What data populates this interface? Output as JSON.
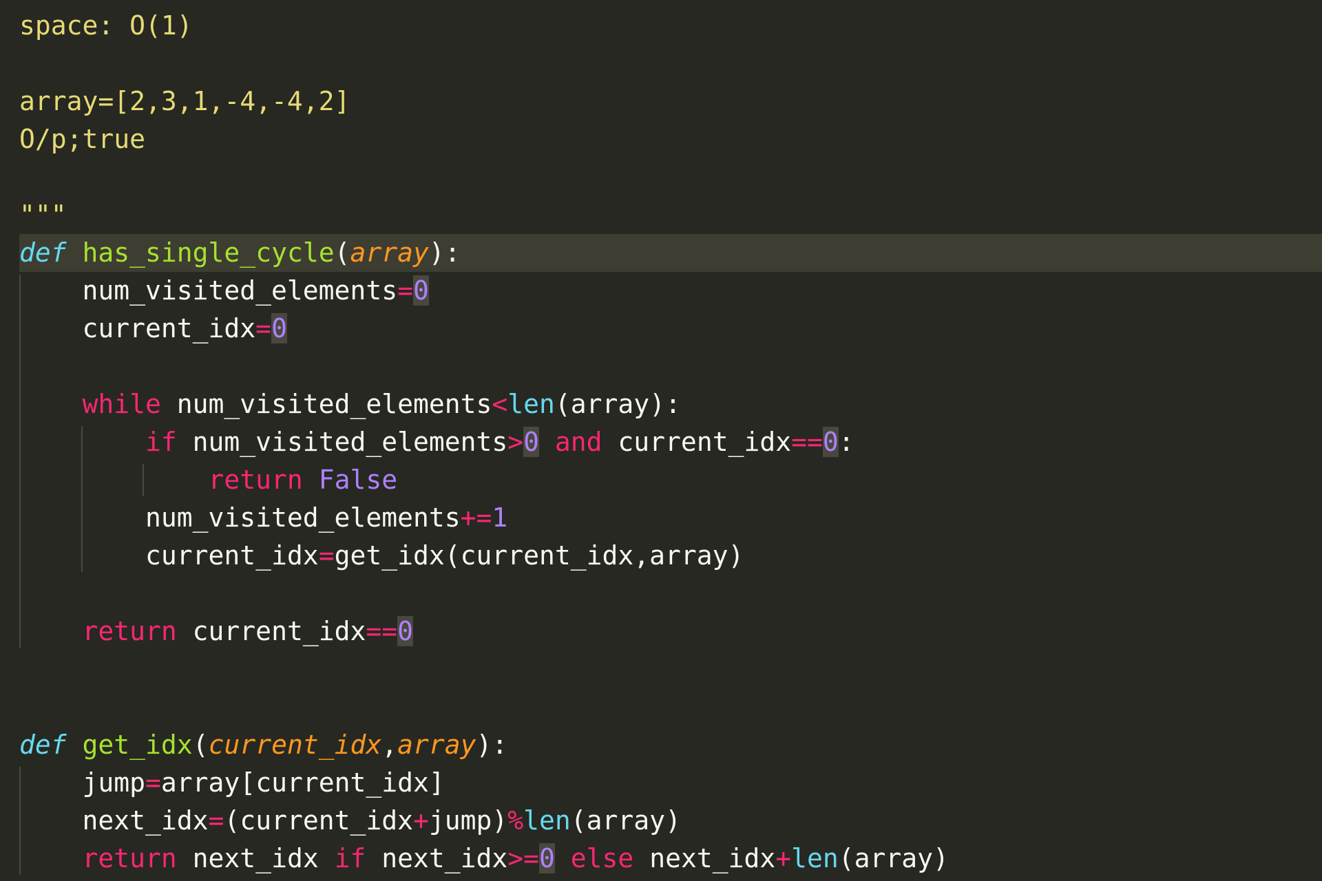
{
  "editor": {
    "theme": "monokai",
    "colors": {
      "background": "#272822",
      "current_line": "#3e3d32",
      "text": "#f8f8f2",
      "string": "#e6db74",
      "keyword": "#f92672",
      "function": "#a6e22e",
      "storage": "#66d9ef",
      "parameter": "#fd971f",
      "number": "#ae81ff",
      "bracket_match_bg": "#49483e"
    },
    "highlighted_line": 6,
    "lines": [
      [
        {
          "t": "space: O(1)",
          "k": "str"
        }
      ],
      [],
      [
        {
          "t": "array=[2,3,1,-4,-4,2]",
          "k": "str"
        }
      ],
      [
        {
          "t": "O/p;true",
          "k": "str"
        }
      ],
      [],
      [
        {
          "t": "\"\"\"",
          "k": "str"
        }
      ],
      [
        {
          "t": "def",
          "k": "def"
        },
        {
          "t": " ",
          "k": "plain"
        },
        {
          "t": "has_single_cycle",
          "k": "fn"
        },
        {
          "t": "(",
          "k": "plain"
        },
        {
          "t": "array",
          "k": "param"
        },
        {
          "t": "):",
          "k": "plain"
        }
      ],
      [
        {
          "t": "    num_visited_elements",
          "k": "plain"
        },
        {
          "t": "=",
          "k": "op"
        },
        {
          "t": "0",
          "k": "num-hl"
        }
      ],
      [
        {
          "t": "    current_idx",
          "k": "plain"
        },
        {
          "t": "=",
          "k": "op"
        },
        {
          "t": "0",
          "k": "num-hl"
        }
      ],
      [],
      [
        {
          "t": "    ",
          "k": "plain"
        },
        {
          "t": "while",
          "k": "kw"
        },
        {
          "t": " num_visited_elements",
          "k": "plain"
        },
        {
          "t": "<",
          "k": "op"
        },
        {
          "t": "len",
          "k": "builtin"
        },
        {
          "t": "(array):",
          "k": "plain"
        }
      ],
      [
        {
          "t": "        ",
          "k": "plain"
        },
        {
          "t": "if",
          "k": "kw"
        },
        {
          "t": " num_visited_elements",
          "k": "plain"
        },
        {
          "t": ">",
          "k": "op"
        },
        {
          "t": "0",
          "k": "num-hl"
        },
        {
          "t": " ",
          "k": "plain"
        },
        {
          "t": "and",
          "k": "kw"
        },
        {
          "t": " current_idx",
          "k": "plain"
        },
        {
          "t": "==",
          "k": "op"
        },
        {
          "t": "0",
          "k": "num-hl"
        },
        {
          "t": ":",
          "k": "plain"
        }
      ],
      [
        {
          "t": "            ",
          "k": "plain"
        },
        {
          "t": "return",
          "k": "kw"
        },
        {
          "t": " ",
          "k": "plain"
        },
        {
          "t": "False",
          "k": "const"
        }
      ],
      [
        {
          "t": "        num_visited_elements",
          "k": "plain"
        },
        {
          "t": "+=",
          "k": "op"
        },
        {
          "t": "1",
          "k": "num"
        }
      ],
      [
        {
          "t": "        current_idx",
          "k": "plain"
        },
        {
          "t": "=",
          "k": "op"
        },
        {
          "t": "get_idx(current_idx,array)",
          "k": "plain"
        }
      ],
      [],
      [
        {
          "t": "    ",
          "k": "plain"
        },
        {
          "t": "return",
          "k": "kw"
        },
        {
          "t": " current_idx",
          "k": "plain"
        },
        {
          "t": "==",
          "k": "op"
        },
        {
          "t": "0",
          "k": "num-hl"
        }
      ],
      [],
      [],
      [
        {
          "t": "def",
          "k": "def"
        },
        {
          "t": " ",
          "k": "plain"
        },
        {
          "t": "get_idx",
          "k": "fn"
        },
        {
          "t": "(",
          "k": "plain"
        },
        {
          "t": "current_idx",
          "k": "param"
        },
        {
          "t": ",",
          "k": "plain"
        },
        {
          "t": "array",
          "k": "param"
        },
        {
          "t": "):",
          "k": "plain"
        }
      ],
      [
        {
          "t": "    jump",
          "k": "plain"
        },
        {
          "t": "=",
          "k": "op"
        },
        {
          "t": "array[current_idx]",
          "k": "plain"
        }
      ],
      [
        {
          "t": "    next_idx",
          "k": "plain"
        },
        {
          "t": "=",
          "k": "op"
        },
        {
          "t": "(current_idx",
          "k": "plain"
        },
        {
          "t": "+",
          "k": "op"
        },
        {
          "t": "jump)",
          "k": "plain"
        },
        {
          "t": "%",
          "k": "op"
        },
        {
          "t": "len",
          "k": "builtin"
        },
        {
          "t": "(array)",
          "k": "plain"
        }
      ],
      [
        {
          "t": "    ",
          "k": "plain"
        },
        {
          "t": "return",
          "k": "kw"
        },
        {
          "t": " next_idx ",
          "k": "plain"
        },
        {
          "t": "if",
          "k": "kw"
        },
        {
          "t": " next_idx",
          "k": "plain"
        },
        {
          "t": ">=",
          "k": "op"
        },
        {
          "t": "0",
          "k": "num-hl"
        },
        {
          "t": " ",
          "k": "plain"
        },
        {
          "t": "else",
          "k": "kw"
        },
        {
          "t": " next_idx",
          "k": "plain"
        },
        {
          "t": "+",
          "k": "op"
        },
        {
          "t": "len",
          "k": "builtin"
        },
        {
          "t": "(array)",
          "k": "plain"
        }
      ]
    ]
  }
}
